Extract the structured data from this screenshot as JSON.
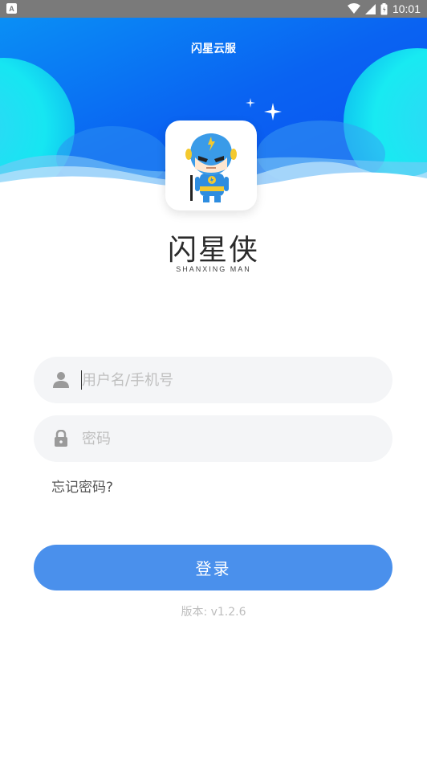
{
  "status_bar": {
    "app_indicator": "A",
    "time": "10:01",
    "icons": [
      "wifi-icon",
      "cell-signal-icon",
      "battery-icon"
    ]
  },
  "header": {
    "title": "闪星云服"
  },
  "brand": {
    "name": "闪星侠",
    "subtitle": "SHANXING MAN"
  },
  "login_form": {
    "username_placeholder": "用户名/手机号",
    "password_placeholder": "密码",
    "forgot_password": "忘记密码?",
    "login_button": "登录"
  },
  "footer": {
    "version": "版本: v1.2.6"
  },
  "colors": {
    "header_blue": "#0a5ff2",
    "accent_cyan": "#16e6f2",
    "button_blue": "#4a90ec",
    "field_bg": "#f4f5f7"
  }
}
